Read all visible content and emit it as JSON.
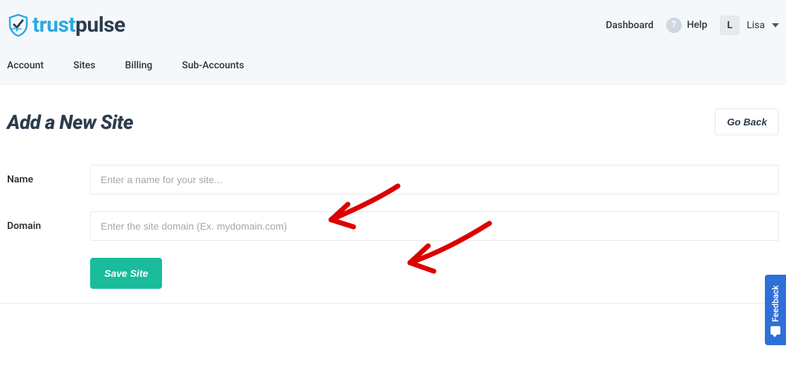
{
  "brand": {
    "name_part1": "trust",
    "name_part2": "pulse"
  },
  "topnav": {
    "dashboard": "Dashboard",
    "help": "Help",
    "user_initial": "L",
    "user_name": "Lisa"
  },
  "tabs": {
    "account": "Account",
    "sites": "Sites",
    "billing": "Billing",
    "subaccounts": "Sub-Accounts"
  },
  "page": {
    "title": "Add a New Site",
    "go_back": "Go Back"
  },
  "form": {
    "name_label": "Name",
    "name_placeholder": "Enter a name for your site...",
    "name_value": "",
    "domain_label": "Domain",
    "domain_placeholder": "Enter the site domain (Ex. mydomain.com)",
    "domain_value": "",
    "save_label": "Save Site"
  },
  "feedback": {
    "label": "Feedback"
  },
  "colors": {
    "accent": "#29a9e1",
    "primary_btn": "#1abc9c",
    "feedback": "#2e6fd9"
  }
}
